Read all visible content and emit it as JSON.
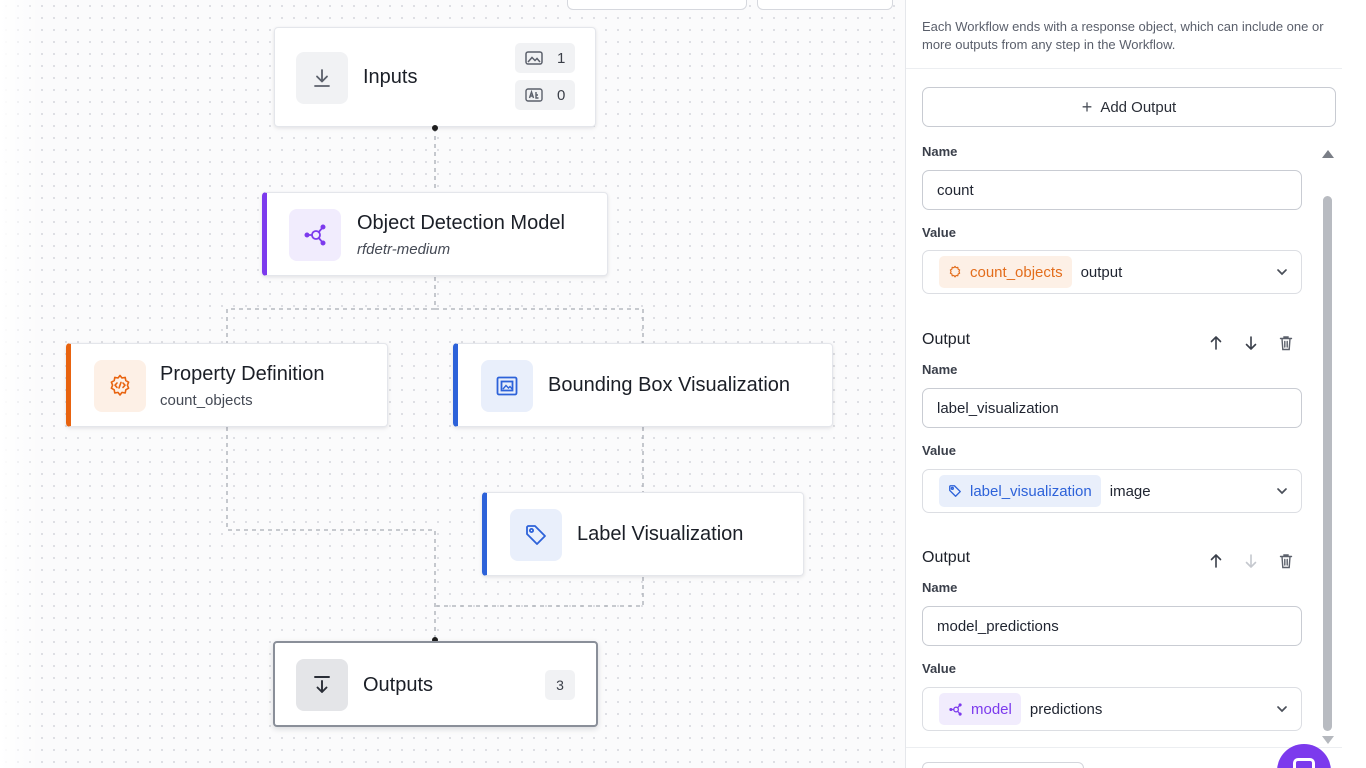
{
  "canvas": {
    "nodes": {
      "inputs": {
        "title": "Inputs",
        "image_count": "1",
        "param_count": "0"
      },
      "object_detection": {
        "title": "Object Detection Model",
        "subtitle": "rfdetr-medium"
      },
      "property_definition": {
        "title": "Property Definition",
        "subtitle": "count_objects"
      },
      "bounding_box": {
        "title": "Bounding Box Visualization"
      },
      "label_visualization": {
        "title": "Label Visualization"
      },
      "outputs": {
        "title": "Outputs",
        "count": "3"
      }
    }
  },
  "panel": {
    "description": "Each Workflow ends with a response object, which can include one or more outputs from any step in the Workflow.",
    "add_output_label": "Add Output",
    "name_label": "Name",
    "value_label": "Value",
    "output_title": "Output",
    "outputs": [
      {
        "name": "count",
        "source": "count_objects",
        "kind": "output",
        "color": "#e36d1c"
      },
      {
        "name": "label_visualization",
        "source": "label_visualization",
        "kind": "image",
        "color": "#2d62d9"
      },
      {
        "name": "model_predictions",
        "source": "model",
        "kind": "predictions",
        "color": "#7c3aed"
      }
    ]
  },
  "colors": {
    "purple_accent": "#7c3aed",
    "orange_accent": "#e8630f",
    "blue_accent": "#2d62d9"
  }
}
